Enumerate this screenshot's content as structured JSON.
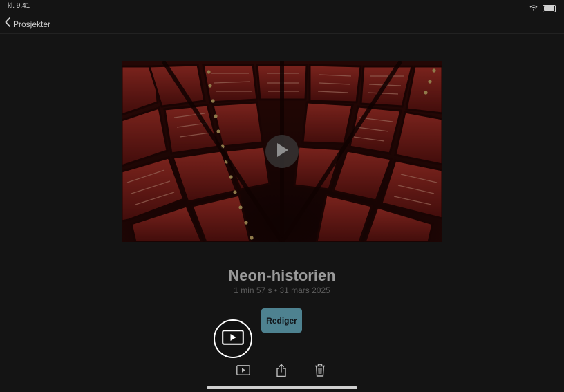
{
  "status_bar": {
    "time": "kl. 9.41"
  },
  "nav": {
    "back_label": "Prosjekter"
  },
  "project": {
    "title": "Neon-historien",
    "meta": "1 min 57 s • 31 mars 2025",
    "edit_label": "Rediger"
  },
  "icons": {
    "back": "chevron-left-icon",
    "play": "play-icon",
    "share": "share-icon",
    "trash": "trash-icon",
    "wifi": "wifi-icon",
    "battery": "battery-icon"
  },
  "colors": {
    "background": "#141414",
    "edit_button": "#4e8290",
    "highlight_ring": "#ffffff",
    "neon_red": "#b3302a"
  }
}
